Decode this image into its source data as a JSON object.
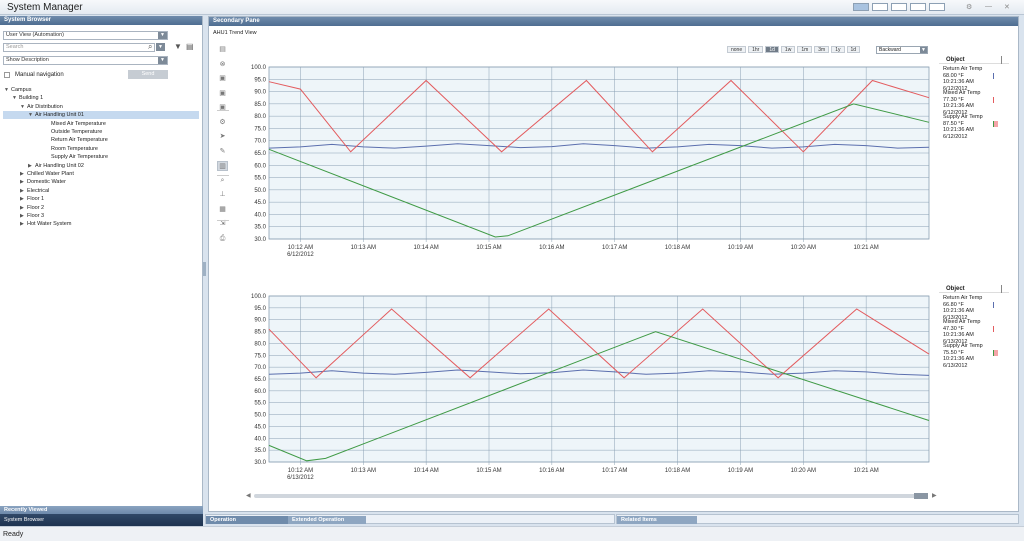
{
  "app": {
    "title": "System Manager",
    "status": "Ready"
  },
  "left": {
    "header": "System Browser",
    "view_select": "User View (Automation)",
    "search_placeholder": "Search",
    "description_select": "Show Description",
    "manual_nav": "Manual navigation",
    "send_label": "Send",
    "tree": [
      {
        "label": "Campus",
        "level": 0,
        "expander": "open"
      },
      {
        "label": "Building 1",
        "level": 1,
        "expander": "open"
      },
      {
        "label": "Air Distribution",
        "level": 2,
        "expander": "open"
      },
      {
        "label": "Air Handling Unit 01",
        "level": 3,
        "expander": "open",
        "selected": true
      },
      {
        "label": "Mixed Air Temperature",
        "level": 5,
        "expander": "none"
      },
      {
        "label": "Outside Temperature",
        "level": 5,
        "expander": "none"
      },
      {
        "label": "Return Air Temperature",
        "level": 5,
        "expander": "none"
      },
      {
        "label": "Room Temperature",
        "level": 5,
        "expander": "none"
      },
      {
        "label": "Supply Air Temperature",
        "level": 5,
        "expander": "none"
      },
      {
        "label": "Air Handling Unit 02",
        "level": 3,
        "expander": "closed"
      },
      {
        "label": "Chilled Water Plant",
        "level": 2,
        "expander": "closed"
      },
      {
        "label": "Domestic Water",
        "level": 2,
        "expander": "closed"
      },
      {
        "label": "Electrical",
        "level": 2,
        "expander": "closed"
      },
      {
        "label": "Floor 1",
        "level": 2,
        "expander": "closed"
      },
      {
        "label": "Floor 2",
        "level": 2,
        "expander": "closed"
      },
      {
        "label": "Floor 3",
        "level": 2,
        "expander": "closed"
      },
      {
        "label": "Hot Water System",
        "level": 2,
        "expander": "closed"
      }
    ],
    "footer_recent": "Recently Viewed",
    "footer_browser": "System Browser"
  },
  "right": {
    "header": "Secondary Pane",
    "subtitle": "AHU1 Trend View",
    "ranges": [
      {
        "label": "none",
        "active": false
      },
      {
        "label": "1hr",
        "active": false
      },
      {
        "label": "1d",
        "active": true
      },
      {
        "label": "1w",
        "active": false
      },
      {
        "label": "1m",
        "active": false
      },
      {
        "label": "3m",
        "active": false
      },
      {
        "label": "1y",
        "active": false
      },
      {
        "label": "1d",
        "active": false
      }
    ],
    "direction": "Backward",
    "tools": [
      "page-settings-icon",
      "close-circle-icon",
      "save-icon",
      "save-as-icon",
      "save-all-icon",
      "gear-icon",
      "cursor-icon",
      "edit-icon",
      "chart-icon",
      "zoom-icon",
      "scale-icon",
      "table-icon",
      "export-icon",
      "print-icon"
    ],
    "colors": {
      "return": "#5b6fae",
      "mixed": "#e35b5e",
      "supply": "#3f9a45",
      "grid": "#8aa0b3"
    }
  },
  "bottom": {
    "tab1": "Operation",
    "tab2": "Extended Operation",
    "tab3": "Related Items"
  },
  "chart_data": [
    {
      "type": "line",
      "y_ticks": [
        "100.0",
        "95.0",
        "90.0",
        "85.0",
        "80.0",
        "75.0",
        "70.0",
        "65.0",
        "60.0",
        "55.0",
        "50.0",
        "45.0",
        "40.0",
        "35.0",
        "30.0"
      ],
      "ylim": [
        30,
        100
      ],
      "xlim": [
        0,
        10.5
      ],
      "x_ticks": [
        {
          "label": "10:12 AM",
          "sub": "6/12/2012",
          "x": 0.5
        },
        {
          "label": "10:13 AM",
          "sub": "",
          "x": 1.5
        },
        {
          "label": "10:14 AM",
          "sub": "",
          "x": 2.5
        },
        {
          "label": "10:15 AM",
          "sub": "",
          "x": 3.5
        },
        {
          "label": "10:16 AM",
          "sub": "",
          "x": 4.5
        },
        {
          "label": "10:17 AM",
          "sub": "",
          "x": 5.5
        },
        {
          "label": "10:18 AM",
          "sub": "",
          "x": 6.5
        },
        {
          "label": "10:19 AM",
          "sub": "",
          "x": 7.5
        },
        {
          "label": "10:20 AM",
          "sub": "",
          "x": 8.5
        },
        {
          "label": "10:21 AM",
          "sub": "",
          "x": 9.5
        }
      ],
      "series": [
        {
          "name": "Return Air Temp",
          "color": "#5b6fae",
          "value": "68.00 °F",
          "time": "10:21:36 AM",
          "date": "6/12/2012",
          "x": [
            0,
            0.5,
            1,
            1.5,
            2,
            2.5,
            3,
            3.5,
            4,
            4.5,
            5,
            5.5,
            6,
            6.5,
            7,
            7.5,
            8,
            8.5,
            9,
            9.5,
            10,
            10.5
          ],
          "y": [
            67,
            67.5,
            68.5,
            67.5,
            67,
            67.8,
            68.8,
            68,
            67.2,
            67.6,
            68.8,
            68,
            67,
            67.5,
            68.5,
            68,
            67,
            67.5,
            68.5,
            68,
            67,
            67.3
          ]
        },
        {
          "name": "Mixed Air Temp",
          "color": "#e35b5e",
          "value": "77.30 °F",
          "time": "10:21:36 AM",
          "date": "6/12/2012",
          "x": [
            0,
            0.5,
            1.3,
            2.5,
            3.7,
            5.05,
            6.1,
            7.35,
            8.5,
            9.6,
            10.5
          ],
          "y": [
            94,
            91,
            65.5,
            94.5,
            65.5,
            94.5,
            65.5,
            94.5,
            65.5,
            94.5,
            87.5
          ]
        },
        {
          "name": "Supply Air Temp",
          "color": "#3f9a45",
          "value": "87.50 °F",
          "time": "10:21:36 AM",
          "date": "6/12/2012",
          "x": [
            0,
            3.6,
            3.8,
            9.3,
            10.5
          ],
          "y": [
            66.5,
            30.8,
            31.3,
            85,
            77.5
          ]
        }
      ]
    },
    {
      "type": "line",
      "y_ticks": [
        "100.0",
        "95.0",
        "90.0",
        "85.0",
        "80.0",
        "75.0",
        "70.0",
        "65.0",
        "60.0",
        "55.0",
        "50.0",
        "45.0",
        "40.0",
        "35.0",
        "30.0"
      ],
      "ylim": [
        30,
        100
      ],
      "xlim": [
        0,
        10.5
      ],
      "x_ticks": [
        {
          "label": "10:12 AM",
          "sub": "6/13/2012",
          "x": 0.5
        },
        {
          "label": "10:13 AM",
          "sub": "",
          "x": 1.5
        },
        {
          "label": "10:14 AM",
          "sub": "",
          "x": 2.5
        },
        {
          "label": "10:15 AM",
          "sub": "",
          "x": 3.5
        },
        {
          "label": "10:16 AM",
          "sub": "",
          "x": 4.5
        },
        {
          "label": "10:17 AM",
          "sub": "",
          "x": 5.5
        },
        {
          "label": "10:18 AM",
          "sub": "",
          "x": 6.5
        },
        {
          "label": "10:19 AM",
          "sub": "",
          "x": 7.5
        },
        {
          "label": "10:20 AM",
          "sub": "",
          "x": 8.5
        },
        {
          "label": "10:21 AM",
          "sub": "",
          "x": 9.5
        }
      ],
      "series": [
        {
          "name": "Return Air Temp",
          "color": "#5b6fae",
          "value": "66.80 °F",
          "time": "10:21:36 AM",
          "date": "6/13/2012",
          "x": [
            0,
            0.5,
            1,
            1.5,
            2,
            2.5,
            3,
            3.5,
            4,
            4.5,
            5,
            5.5,
            6,
            6.5,
            7,
            7.5,
            8,
            8.5,
            9,
            9.5,
            10,
            10.5
          ],
          "y": [
            67,
            67.5,
            68.5,
            67.5,
            67,
            67.8,
            68.8,
            68,
            67.2,
            67.6,
            68.8,
            68,
            67,
            67.5,
            68.5,
            68,
            67,
            67.5,
            68.5,
            68,
            67,
            66.5
          ]
        },
        {
          "name": "Mixed Air Temp",
          "color": "#e35b5e",
          "value": "47.30 °F",
          "time": "10:21:36 AM",
          "date": "6/13/2012",
          "x": [
            0,
            0.75,
            1.95,
            3.2,
            4.45,
            5.65,
            6.9,
            8.1,
            9.35,
            10.5
          ],
          "y": [
            86,
            65.5,
            94.5,
            65.5,
            94.5,
            65.5,
            94.5,
            65.5,
            94.5,
            75.5
          ]
        },
        {
          "name": "Supply Air Temp",
          "color": "#3f9a45",
          "value": "75.50 °F",
          "time": "10:21:36 AM",
          "date": "6/13/2012",
          "x": [
            0,
            0.6,
            0.9,
            6.15,
            10.5
          ],
          "y": [
            37,
            30.5,
            31.5,
            85,
            47.5
          ]
        }
      ]
    }
  ]
}
